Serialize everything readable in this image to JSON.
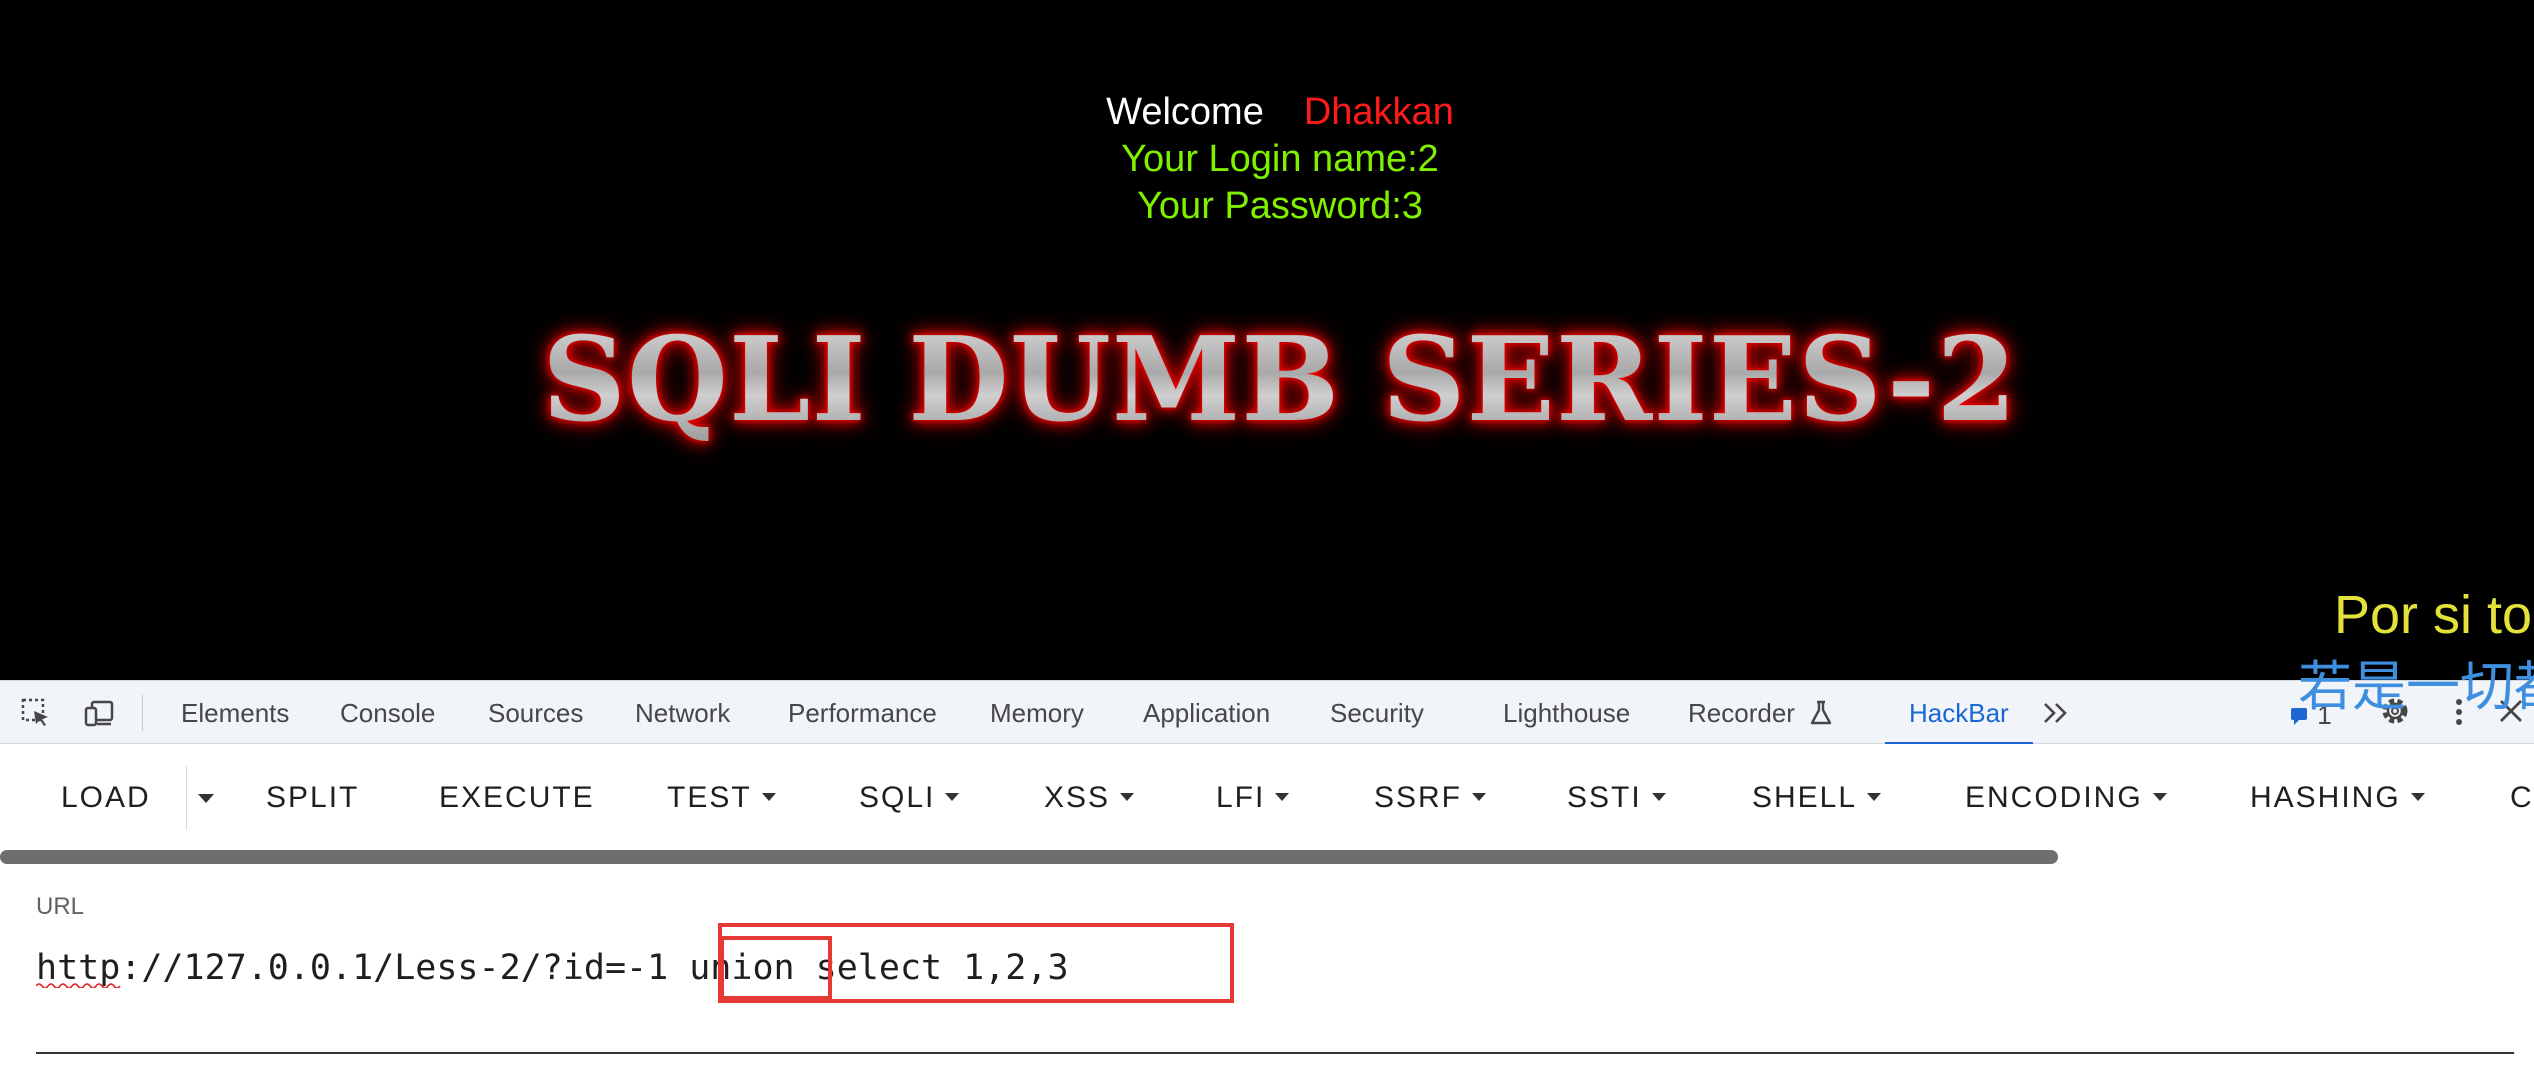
{
  "page": {
    "welcome_label": "Welcome",
    "username": "Dhakkan",
    "login_line": "Your Login name:2",
    "password_line": "Your Password:3",
    "banner": "SQLI DUMB SERIES-2",
    "marquee_es": "Por si to",
    "marquee_zh": "若是一切都",
    "colors": {
      "background": "#000000",
      "welcome": "#ffffff",
      "username": "#ff1a1a",
      "credentials": "#7ff000",
      "banner_glow": "#ff0000",
      "marquee_es": "#e2e23a",
      "marquee_zh": "#3e8fe0"
    }
  },
  "devtools": {
    "tabs": [
      "Elements",
      "Console",
      "Sources",
      "Network",
      "Performance",
      "Memory",
      "Application",
      "Security",
      "Lighthouse",
      "Recorder",
      "HackBar"
    ],
    "active_tab": "HackBar",
    "issues_count": "1",
    "icons": [
      "inspect-element-icon",
      "device-toolbar-icon",
      "flask-icon",
      "more-tabs-chevron-icon",
      "issues-icon",
      "gear-icon",
      "kebab-menu-icon",
      "close-icon"
    ],
    "accent_color": "#1a67d2"
  },
  "hackbar": {
    "buttons": [
      {
        "label": "LOAD"
      },
      {
        "label": "SPLIT"
      },
      {
        "label": "EXECUTE"
      },
      {
        "label": "TEST"
      },
      {
        "label": "SQLI"
      },
      {
        "label": "XSS"
      },
      {
        "label": "LFI"
      },
      {
        "label": "SSRF"
      },
      {
        "label": "SSTI"
      },
      {
        "label": "SHELL"
      },
      {
        "label": "ENCODING"
      },
      {
        "label": "HASHING"
      },
      {
        "label": "C"
      }
    ],
    "url_label": "URL",
    "url_value": "http://127.0.0.1/Less-2/?id=-1 union select 1,2,3",
    "annotation_color": "#e53935"
  }
}
